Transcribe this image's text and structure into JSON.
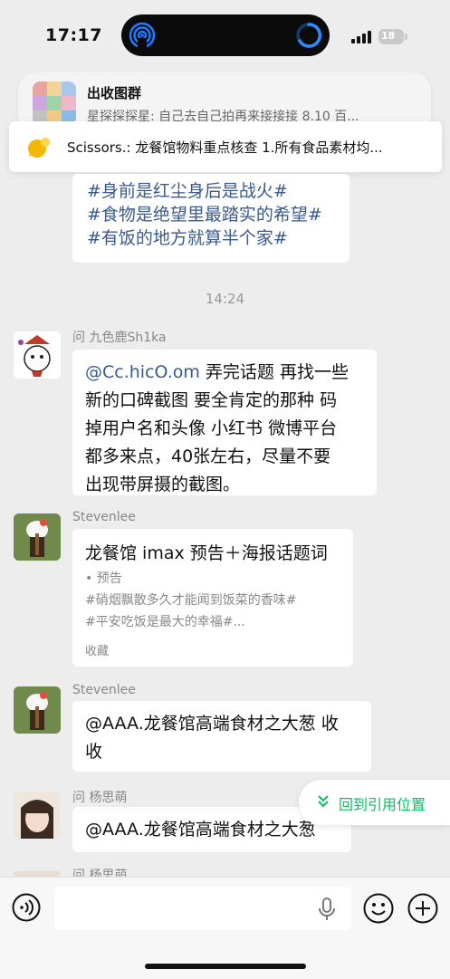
{
  "status": {
    "time": "17:17",
    "battery": "18"
  },
  "notification": {
    "title": "出收图群",
    "body": "星探探探星: 自己去自己拍再来接接接 8.10 百..."
  },
  "pinned_banner": {
    "text": "Scissors.: 龙餐馆物料重点核查 1.所有食品素材均..."
  },
  "top_message": {
    "lines": [
      "#身前是红尘身后是战火#",
      "#食物是绝望里最踏实的希望#",
      "#有饭的地方就算半个家#"
    ]
  },
  "time_separator": "14:24",
  "messages": [
    {
      "sender": "问 九色鹿Sh1ka",
      "lines": [
        "@Cc.hicO.om 弄完话题 再找一些",
        "新的口碑截图 要全肯定的那种 码",
        "掉用户名和头像 小红书 微博平台",
        "都多来点，40张左右，尽量不要",
        "出现带屏摄的截图。"
      ]
    },
    {
      "sender": "Stevenlee",
      "favorite": {
        "title": "龙餐馆 imax 预告＋海报话题词",
        "line1": "• 预告",
        "line2": "#硝烟飘散多久才能闻到饭菜的香味#",
        "line3": "#平安吃饭是最大的幸福#...",
        "source": "收藏"
      }
    },
    {
      "sender": "Stevenlee",
      "lines": [
        "@AAA.龙餐馆高端食材之大葱 收",
        "收"
      ]
    },
    {
      "sender": "问 杨思萌",
      "lines": [
        "@AAA.龙餐馆高端食材之大葱"
      ]
    },
    {
      "sender": "问 杨思萌"
    }
  ],
  "jump_button": {
    "label": "回到引用位置"
  },
  "colors": {
    "accent": "#07c160",
    "background": "#ededed",
    "hashtag": "#3a5a8c"
  }
}
